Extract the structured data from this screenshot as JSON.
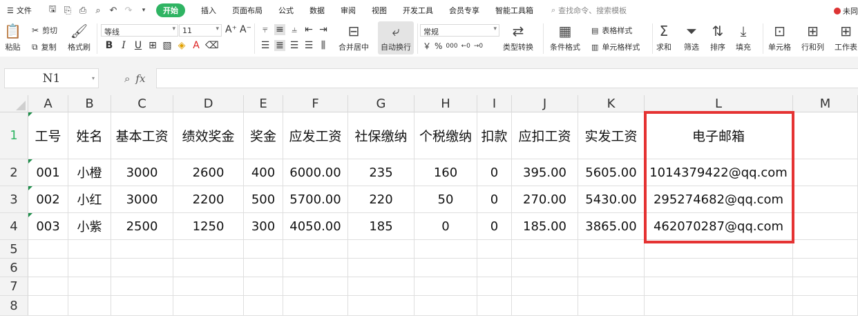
{
  "menubar": {
    "file_label": "文件",
    "tabs": [
      "开始",
      "插入",
      "页面布局",
      "公式",
      "数据",
      "审阅",
      "视图",
      "开发工具",
      "会员专享",
      "智能工具箱"
    ],
    "search_placeholder": "查找命令、搜索模板",
    "account_label": "未同"
  },
  "ribbon": {
    "paste": "粘贴",
    "cut": "剪切",
    "copy": "复制",
    "format_painter": "格式刷",
    "font_name": "等线",
    "font_size": "11",
    "merge_center": "合并居中",
    "wrap_text": "自动换行",
    "number_format": "常规",
    "currency_symbol": "￥",
    "percent_symbol": "%",
    "thousands": "000",
    "type_convert": "类型转换",
    "conditional_format": "条件格式",
    "table_style": "表格样式",
    "cell_style": "单元格样式",
    "sum": "求和",
    "filter": "筛选",
    "sort": "排序",
    "fill": "填充",
    "cell": "单元格",
    "row_col": "行和列",
    "worksheet": "工作表"
  },
  "formula_bar": {
    "name_box": "N1",
    "fx": "fx",
    "content": ""
  },
  "grid": {
    "columns": [
      "A",
      "B",
      "C",
      "D",
      "E",
      "F",
      "G",
      "H",
      "I",
      "J",
      "K",
      "L",
      "M"
    ],
    "row_numbers": [
      "1",
      "2",
      "3",
      "4",
      "5",
      "6",
      "7",
      "8"
    ],
    "headers": [
      "工号",
      "姓名",
      "基本工资",
      "绩效奖金",
      "奖金",
      "应发工资",
      "社保缴纳",
      "个税缴纳",
      "扣款",
      "应扣工资",
      "实发工资",
      "电子邮箱"
    ],
    "rows": [
      [
        "001",
        "小橙",
        "3000",
        "2600",
        "400",
        "6000.00",
        "235",
        "160",
        "0",
        "395.00",
        "5605.00",
        "1014379422@qq.com"
      ],
      [
        "002",
        "小红",
        "3000",
        "2200",
        "500",
        "5700.00",
        "220",
        "50",
        "0",
        "270.00",
        "5430.00",
        "295274682@qq.com"
      ],
      [
        "003",
        "小紫",
        "2500",
        "1250",
        "300",
        "4050.00",
        "185",
        "0",
        "0",
        "185.00",
        "3865.00",
        "462070287@qq.com"
      ]
    ],
    "highlight_color": "#e53333",
    "accent_color": "#2fb463"
  }
}
